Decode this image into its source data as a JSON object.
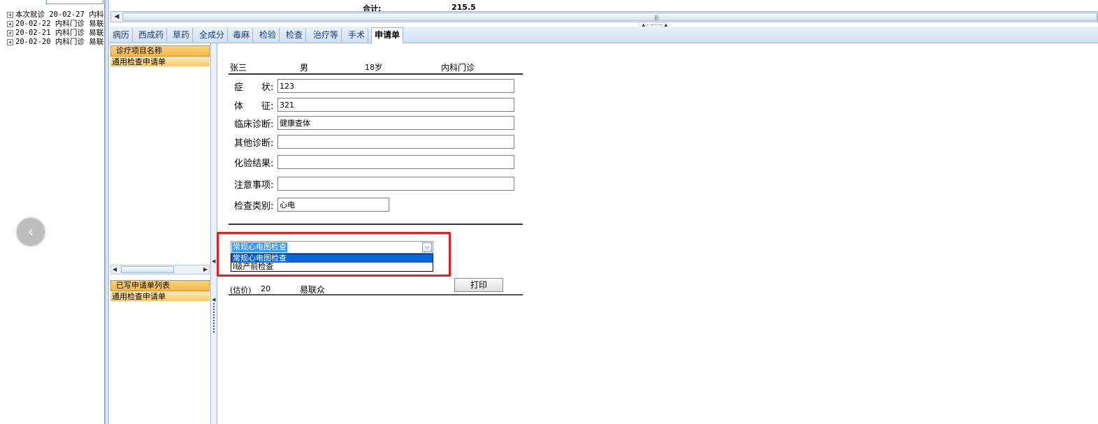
{
  "history": {
    "items": [
      "本次就诊 20-02-27 内科",
      "20-02-22 内科门诊 易联",
      "20-02-21 内科门诊 易联",
      "20-02-20 内科门诊 易联"
    ],
    "expander": "+"
  },
  "summary": {
    "total_label": "合计:",
    "total_value": "215.5"
  },
  "tabs": [
    "病历",
    "西成药",
    "草药",
    "全成分",
    "毒麻",
    "检验",
    "检查",
    "治疗等",
    "手术",
    "申请单"
  ],
  "active_tab": "申请单",
  "project_list": {
    "header": "诊疗项目名称",
    "selected": "通用检查申请单"
  },
  "written_list": {
    "header": "已写申请单列表",
    "selected": "通用检查申请单"
  },
  "patient": {
    "name": "张三",
    "gender": "男",
    "age": "18岁",
    "department": "内科门诊"
  },
  "form": {
    "symptom_label": "症　　状:",
    "symptom_value": "123",
    "sign_label": "体　　征:",
    "sign_value": "321",
    "clinical_dx_label": "临床诊断:",
    "clinical_dx_value": "健康查体",
    "other_dx_label": "其他诊断:",
    "other_dx_value": "",
    "lab_result_label": "化验结果:",
    "lab_result_value": "",
    "notes_label": "注意事项:",
    "notes_value": "",
    "exam_type_label": "检查类别:",
    "exam_type_value": "心电"
  },
  "exam_item": {
    "selected": "常规心电图检查",
    "options": [
      "常规心电图检查",
      "Ⅰ级产前检查"
    ]
  },
  "footer": {
    "estimate_label": "(估价)",
    "estimate_value": "20",
    "doctor": "易联众",
    "print_label": "打印"
  },
  "colors": {
    "highlight": "#e02020",
    "selection": "#0a64d6",
    "list_header": "#f5b746"
  },
  "icons": {
    "back": "chevron-left-icon",
    "dropdown": "chevron-down-icon"
  }
}
